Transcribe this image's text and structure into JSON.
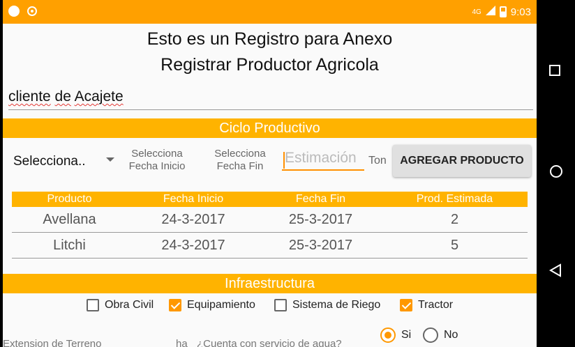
{
  "status_bar": {
    "network": "4G",
    "time": "9:03"
  },
  "header": {
    "line1": "Esto es un Registro para Anexo",
    "line2": "Registrar Productor Agricola"
  },
  "cliente_field": {
    "word1": "cliente",
    "word2": "de",
    "word3": "Acajete"
  },
  "ciclo": {
    "title": "Ciclo Productivo",
    "spinner_value": "Selecciona..",
    "fecha_inicio_l1": "Selecciona",
    "fecha_inicio_l2": "Fecha Inicio",
    "fecha_fin_l1": "Selecciona",
    "fecha_fin_l2": "Fecha Fin",
    "estimacion_placeholder": "Estimación",
    "unit": "Ton",
    "add_button": "AGREGAR PRODUCTO"
  },
  "table": {
    "headers": [
      "Producto",
      "Fecha Inicio",
      "Fecha Fin",
      "Prod. Estimada"
    ],
    "rows": [
      [
        "Avellana",
        "24-3-2017",
        "25-3-2017",
        "2"
      ],
      [
        "Litchi",
        "24-3-2017",
        "25-3-2017",
        "5"
      ]
    ]
  },
  "infra": {
    "title": "Infraestructura",
    "options": [
      {
        "label": "Obra Civil",
        "checked": false
      },
      {
        "label": "Equipamiento",
        "checked": true
      },
      {
        "label": "Sistema de Riego",
        "checked": false
      },
      {
        "label": "Tractor",
        "checked": true
      }
    ]
  },
  "bottom": {
    "extension_label": "Extension de Terreno",
    "unit_ha": "ha",
    "agua_question": "¿Cuenta con servicio de agua?",
    "radio_si": "Si",
    "radio_no": "No",
    "selected": "Si"
  },
  "colors": {
    "accent": "#ffb300",
    "status_bar": "#ffa000",
    "checked": "#ff9800"
  }
}
